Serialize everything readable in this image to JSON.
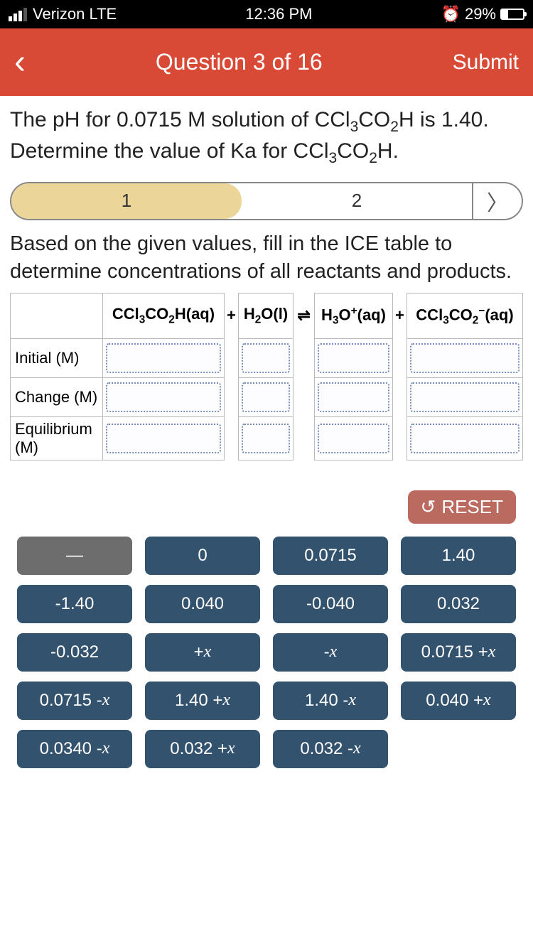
{
  "status": {
    "carrier": "Verizon  LTE",
    "time": "12:36 PM",
    "battery_pct": "29%"
  },
  "nav": {
    "title": "Question 3 of 16",
    "submit": "Submit"
  },
  "question_html": "The pH for 0.0715 M solution of CCl<sub>3</sub>CO<sub>2</sub>H is 1.40. Determine the value of Ka for CCl<sub>3</sub>CO<sub>2</sub>H.",
  "steps": {
    "s1": "1",
    "s2": "2"
  },
  "instruction": "Based on the given values, fill in the ICE table to determine concentrations of all reactants and products.",
  "table": {
    "col1": "CCl<sub>3</sub>CO<sub>2</sub>H(aq)",
    "plus1": "+",
    "col2": "H<sub>2</sub>O(l)",
    "eq": "⇌",
    "col3": "H<sub>3</sub>O<sup>+</sup>(aq)",
    "plus2": "+",
    "col4": "CCl<sub>3</sub>CO<sub>2</sub><sup>−</sup>(aq)",
    "rows": [
      "Initial (M)",
      "Change (M)",
      "Equilibrium (M)"
    ]
  },
  "reset": "RESET",
  "tiles": [
    "—",
    "0",
    "0.0715",
    "1.40",
    "-1.40",
    "0.040",
    "-0.040",
    "0.032",
    "-0.032",
    "+x",
    "-x",
    "0.0715 + x",
    "0.0715 - x",
    "1.40 + x",
    "1.40 - x",
    "0.040 + x",
    "0.0340 - x",
    "0.032 + x",
    "0.032 - x"
  ]
}
